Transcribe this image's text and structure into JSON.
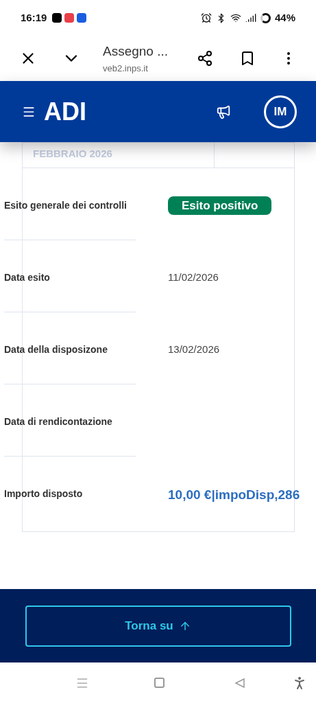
{
  "status_bar": {
    "time": "16:19",
    "battery": "44%"
  },
  "browser_bar": {
    "title": "Assegno ...",
    "url": "veb2.inps.it"
  },
  "header": {
    "title": "ADI",
    "avatar": "IM"
  },
  "partial_row": {
    "label": "FEBBRAIO 2026"
  },
  "rows": [
    {
      "kind": "badge",
      "label": "Esito generale dei controlli",
      "value": "Esito positivo"
    },
    {
      "kind": "text",
      "label": "Data esito",
      "value": "11/02/2026"
    },
    {
      "kind": "text",
      "label": "Data della disposizone",
      "value": "13/02/2026"
    },
    {
      "kind": "text",
      "label": "Data di rendicontazione"
    },
    {
      "kind": "amount",
      "label": "Importo disposto",
      "value": "10,00 €|impoDisp,286"
    }
  ],
  "footer": {
    "button": "Torna su"
  }
}
